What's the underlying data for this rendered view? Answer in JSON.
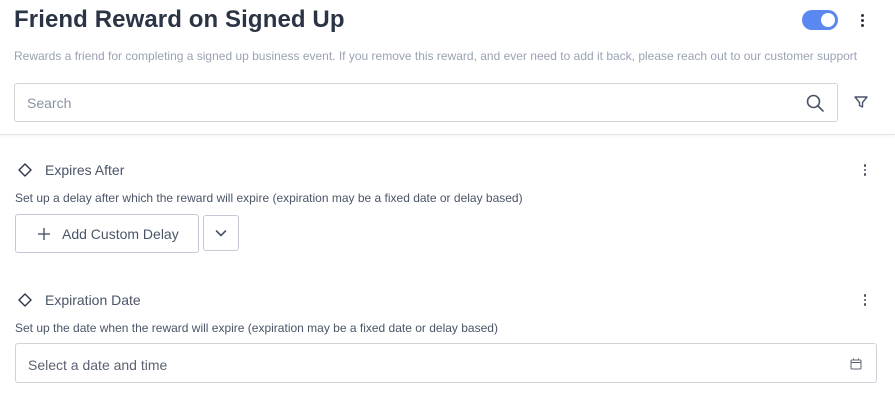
{
  "header": {
    "title": "Friend Reward on Signed Up",
    "toggle_on": true,
    "subtitle": "Rewards a friend for completing a signed up business event. If you remove this reward, and ever need to add it back, please reach out to our customer support",
    "search_placeholder": "Search",
    "search_value": ""
  },
  "expires_after": {
    "title": "Expires After",
    "description": "Set up a delay after which the reward will expire (expiration may be a fixed date or delay based)",
    "add_button_label": "Add Custom Delay"
  },
  "expiration_date": {
    "title": "Expiration Date",
    "description": "Set up the date when the reward will expire (expiration may be a fixed date or delay based)",
    "date_placeholder": "Select a date and time"
  },
  "colors": {
    "toggle_accent": "#5b87f0",
    "title_text": "#2b3445",
    "subtitle_text": "#9aa3b2"
  },
  "icons": [
    "more-vertical-icon",
    "search-icon",
    "filter-icon",
    "diamond-icon",
    "plus-icon",
    "chevron-down-icon",
    "calendar-icon"
  ]
}
